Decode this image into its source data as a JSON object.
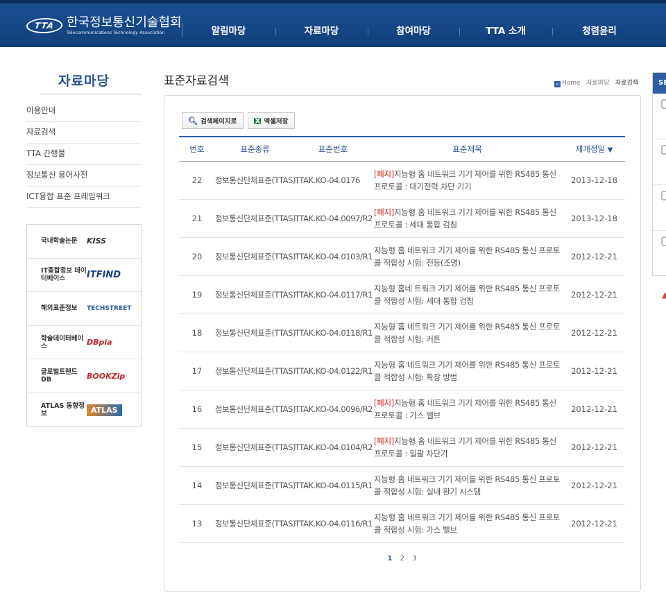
{
  "header": {
    "logo_mark": "TTA",
    "logo_ko": "한국정보통신기술협회",
    "logo_en": "Telecommunications Technology Association",
    "nav": [
      "알림마당",
      "자료마당",
      "참여마당",
      "TTA 소개",
      "청렴윤리"
    ]
  },
  "sidebar": {
    "title": "자료마당",
    "items": [
      "이용안내",
      "자료검색",
      "TTA 간행물",
      "정보통신 용어사전",
      "ICT융합 표준 프레임워크"
    ],
    "banners": [
      {
        "label": "국내학술논문",
        "logo": "KISS"
      },
      {
        "label": "IT종합정보 데이터베이스",
        "logo": "ITFIND"
      },
      {
        "label": "해외표준정보",
        "logo": "TECHSTREET"
      },
      {
        "label": "학술데이터베이스",
        "logo": "DBpia"
      },
      {
        "label": "글로벌트렌드DB",
        "logo": "BOOKZip"
      },
      {
        "label": "ATLAS 동향정보",
        "logo": "ATLAS"
      }
    ]
  },
  "main": {
    "title": "표준자료검색",
    "breadcrumb": [
      "Home",
      "자료마당",
      "자료검색"
    ],
    "buttons": {
      "search_page": "검색페이지로",
      "excel": "엑셀저장"
    },
    "columns": {
      "no": "번호",
      "type": "표준종류",
      "num": "표준번호",
      "title": "표준제목",
      "date": "제개정일",
      "sort": "▼"
    },
    "rows": [
      {
        "no": "22",
        "type": "정보통신단체표준(TTAS)",
        "num": "TTAK.KO-04.0176",
        "tag": "[폐지]",
        "title": "지능형 홈 네트워크 기기 제어를 위한 RS485 통신 프로토콜 : 대기전력 차단 기기",
        "date": "2013-12-18"
      },
      {
        "no": "21",
        "type": "정보통신단체표준(TTAS)",
        "num": "TTAK.KO-04.0097/R2",
        "tag": "[폐지]",
        "title": "지능형 홈 네트워크 기기 제어를 위한 RS485 통신 프로토콜 : 세대 통합 검침",
        "date": "2013-12-18"
      },
      {
        "no": "20",
        "type": "정보통신단체표준(TTAS)",
        "num": "TTAK.KO-04.0103/R1",
        "tag": "",
        "title": "지능형 홈 네트워크 기기 제어를 위한 RS485 통신 프로토콜 적합성 시험: 전등(조명)",
        "date": "2012-12-21"
      },
      {
        "no": "19",
        "type": "정보통신단체표준(TTAS)",
        "num": "TTAK.KO-04.0117/R1",
        "tag": "",
        "title": "지능형 홈네 트워크 기기 제어를 위한 RS485 통신 프로토콜 적합성 시험: 세대 통합 검침",
        "date": "2012-12-21"
      },
      {
        "no": "18",
        "type": "정보통신단체표준(TTAS)",
        "num": "TTAK.KO-04.0118/R1",
        "tag": "",
        "title": "지능형 홈 네트워크 기기 제어를 위한 RS485 통신 프로토콜 적합성 시험: 커튼",
        "date": "2012-12-21"
      },
      {
        "no": "17",
        "type": "정보통신단체표준(TTAS)",
        "num": "TTAK.KO-04.0122/R1",
        "tag": "",
        "title": "지능형 홈 네트워크 기기 제어를 위한 RS485 통신 프로토콜 적합성 시험: 확장 방범",
        "date": "2012-12-21"
      },
      {
        "no": "16",
        "type": "정보통신단체표준(TTAS)",
        "num": "TTAK.KO-04.0096/R2",
        "tag": "[폐지]",
        "title": "지능형 홈 네트워크 기기 제어를 위한 RS485 통신 프로토콜 : 가스 밸브",
        "date": "2012-12-21"
      },
      {
        "no": "15",
        "type": "정보통신단체표준(TTAS)",
        "num": "TTAK.KO-04.0104/R2",
        "tag": "[폐지]",
        "title": "지능형 홈 네트워크 기기 제어를 위한 RS485 통신 프로토콜 : 일괄 차단기",
        "date": "2012-12-21"
      },
      {
        "no": "14",
        "type": "정보통신단체표준(TTAS)",
        "num": "TTAK.KO-04.0115/R1",
        "tag": "",
        "title": "지능형 홈 네트워크 기기 제어를 위한 RS485 통신 프로토콜 적합성 시험: 실내 환기 시스템",
        "date": "2012-12-21"
      },
      {
        "no": "13",
        "type": "정보통신단체표준(TTAS)",
        "num": "TTAK.KO-04.0116/R1",
        "tag": "",
        "title": "지능형 홈 네트워크 기기 제어를 위한 RS485 통신 프로토콜 적합성 시험: 가스 밸브",
        "date": "2012-12-21"
      }
    ],
    "pages": [
      "1",
      "2",
      "3"
    ]
  },
  "right_panel": {
    "head": "SE"
  },
  "colors": {
    "brand": "#1b4f93",
    "accent": "#2f5ea6",
    "abolish": "#d0211c"
  }
}
